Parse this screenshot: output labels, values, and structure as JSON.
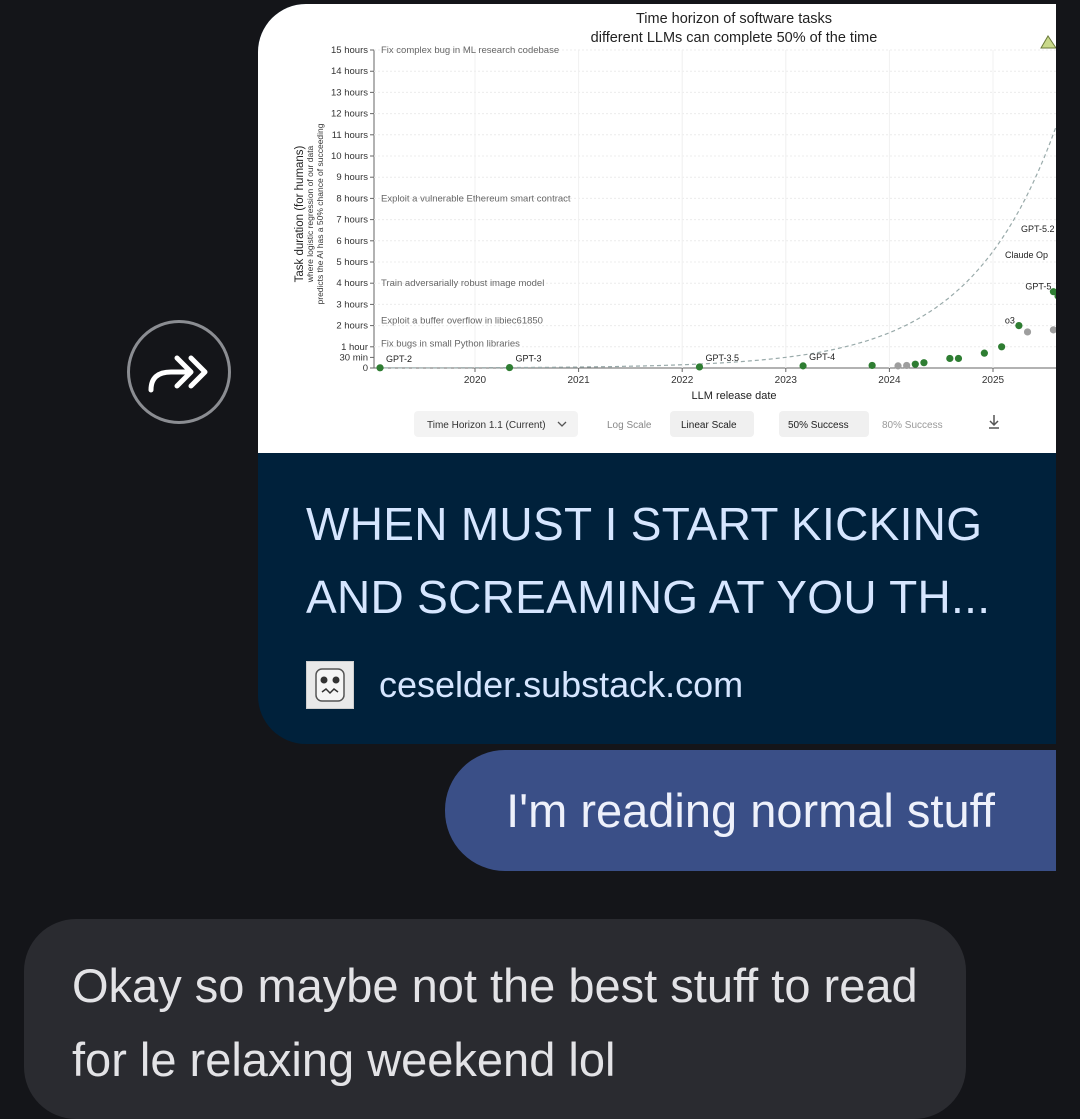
{
  "link_preview": {
    "title": "WHEN MUST I START KICKING AND SCREAMING AT YOU TH...",
    "domain": "ceselder.substack.com",
    "colors": {
      "card_bg": "#00213b",
      "text": "#d6e6ff"
    }
  },
  "share_button_icon": "forward-arrow-icon",
  "messages": {
    "outgoing": {
      "text": "I'm reading normal stuff",
      "bubble_color": "#3a4f87"
    },
    "incoming": {
      "text": "Okay so maybe not the best stuff to read for le relaxing weekend lol",
      "bubble_color": "#2a2b30"
    }
  },
  "chart_data": {
    "type": "scatter",
    "title": "Time horizon of software tasks different LLMs can complete 50% of the time",
    "xlabel": "LLM release date",
    "ylabel": "Task duration (for humans)",
    "ylabel_sub1": "where logistic regression of our data",
    "ylabel_sub2": "predicts the AI has a 50% chance of succeeding",
    "x_ticks": [
      "2020",
      "2021",
      "2022",
      "2023",
      "2024",
      "2025"
    ],
    "y_ticks": [
      "0",
      "30 min",
      "1 hour",
      "2 hours",
      "3 hours",
      "4 hours",
      "5 hours",
      "6 hours",
      "7 hours",
      "8 hours",
      "9 hours",
      "10 hours",
      "11 hours",
      "12 hours",
      "13 hours",
      "14 hours",
      "15 hours"
    ],
    "ylim_hours": [
      0,
      15
    ],
    "annotations": [
      {
        "label": "Fix complex bug in ML research codebase",
        "y_hours": 15
      },
      {
        "label": "Exploit a vulnerable Ethereum smart contract",
        "y_hours": 8
      },
      {
        "label": "Train adversarially robust image model",
        "y_hours": 4
      },
      {
        "label": "Exploit a buffer overflow in libiec61850",
        "y_hours": 2.25
      },
      {
        "label": "Fix bugs in small Python libraries",
        "y_hours": 1.15
      }
    ],
    "points": [
      {
        "label": "GPT-2",
        "x": "2019-02",
        "y_hours": 0.01,
        "color": "#2e7d32"
      },
      {
        "label": "GPT-3",
        "x": "2020-05",
        "y_hours": 0.02,
        "color": "#2e7d32"
      },
      {
        "label": "GPT-3.5",
        "x": "2022-03",
        "y_hours": 0.05,
        "color": "#2e7d32"
      },
      {
        "label": "GPT-4",
        "x": "2023-03",
        "y_hours": 0.1,
        "color": "#2e7d32"
      },
      {
        "label": "",
        "x": "2023-11",
        "y_hours": 0.12,
        "color": "#2e7d32"
      },
      {
        "label": "",
        "x": "2024-02",
        "y_hours": 0.1,
        "color": "#9e9e9e"
      },
      {
        "label": "",
        "x": "2024-03",
        "y_hours": 0.12,
        "color": "#9e9e9e"
      },
      {
        "label": "",
        "x": "2024-04",
        "y_hours": 0.18,
        "color": "#2e7d32"
      },
      {
        "label": "",
        "x": "2024-05",
        "y_hours": 0.25,
        "color": "#2e7d32"
      },
      {
        "label": "",
        "x": "2024-08",
        "y_hours": 0.45,
        "color": "#2e7d32"
      },
      {
        "label": "",
        "x": "2024-09",
        "y_hours": 0.45,
        "color": "#2e7d32"
      },
      {
        "label": "",
        "x": "2024-12",
        "y_hours": 0.7,
        "color": "#2e7d32"
      },
      {
        "label": "",
        "x": "2025-02",
        "y_hours": 1.0,
        "color": "#2e7d32"
      },
      {
        "label": "o3",
        "x": "2025-04",
        "y_hours": 2.0,
        "color": "#2e7d32"
      },
      {
        "label": "",
        "x": "2025-05",
        "y_hours": 1.7,
        "color": "#9e9e9e"
      },
      {
        "label": "GPT-5",
        "x": "2025-08",
        "y_hours": 3.6,
        "color": "#2e7d32"
      },
      {
        "label": "",
        "x": "2025-08",
        "y_hours": 1.8,
        "color": "#9e9e9e"
      }
    ],
    "clipped_labels": [
      "GPT-5.2",
      "Claude Op"
    ],
    "controls": {
      "version": "Time Horizon 1.1 (Current)",
      "log_scale": "Log Scale",
      "linear_scale": "Linear Scale",
      "success_50": "50% Success",
      "success_80": "80% Success"
    }
  }
}
